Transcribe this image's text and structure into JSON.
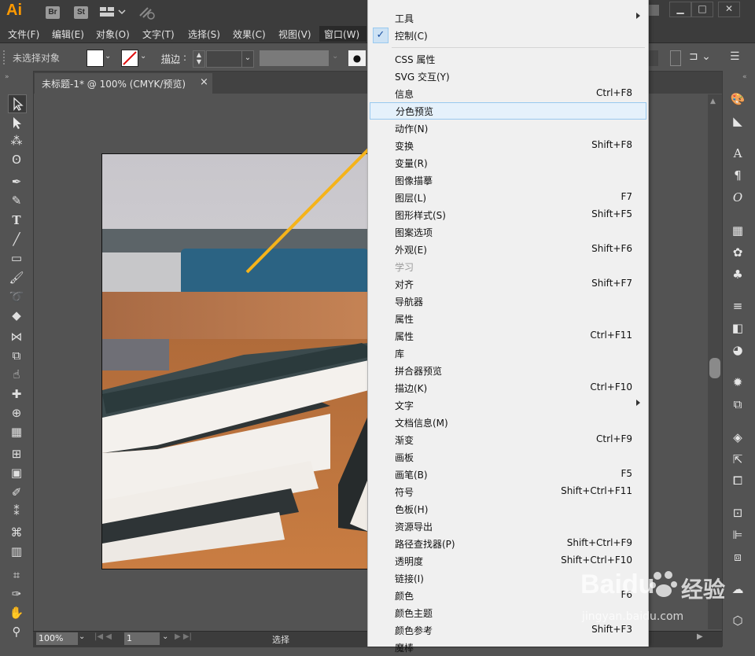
{
  "app": {
    "logo": "Ai",
    "bridge": "Br",
    "stock": "St"
  },
  "menubar": [
    "文件(F)",
    "编辑(E)",
    "对象(O)",
    "文字(T)",
    "选择(S)",
    "效果(C)",
    "视图(V)",
    "窗口(W)"
  ],
  "control_bar": {
    "selection_label": "未选择对象",
    "stroke_label": "描边",
    "colon": ":"
  },
  "document_tab": {
    "title": "未标题-1* @ 100% (CMYK/预览)",
    "close": "×"
  },
  "status_bar": {
    "zoom": "100%",
    "page": "1",
    "tool": "选择"
  },
  "window_menu": {
    "top_items": [
      {
        "label": "工具",
        "submenu": true
      },
      {
        "label": "控制(C)",
        "checked": true
      }
    ],
    "items": [
      {
        "label": "CSS 属性",
        "shortcut": ""
      },
      {
        "label": "SVG 交互(Y)",
        "shortcut": ""
      },
      {
        "label": "信息",
        "shortcut": "Ctrl+F8"
      },
      {
        "label": "分色预览",
        "shortcut": "",
        "highlighted": true
      },
      {
        "label": "动作(N)",
        "shortcut": ""
      },
      {
        "label": "变换",
        "shortcut": "Shift+F8"
      },
      {
        "label": "变量(R)",
        "shortcut": ""
      },
      {
        "label": "图像描摹",
        "shortcut": ""
      },
      {
        "label": "图层(L)",
        "shortcut": "F7"
      },
      {
        "label": "图形样式(S)",
        "shortcut": "Shift+F5"
      },
      {
        "label": "图案选项",
        "shortcut": ""
      },
      {
        "label": "外观(E)",
        "shortcut": "Shift+F6"
      },
      {
        "label": "学习",
        "shortcut": "",
        "disabled": true
      },
      {
        "label": "对齐",
        "shortcut": "Shift+F7"
      },
      {
        "label": "导航器",
        "shortcut": ""
      },
      {
        "label": "属性",
        "shortcut": ""
      },
      {
        "label": "属性",
        "shortcut": "Ctrl+F11"
      },
      {
        "label": "库",
        "shortcut": ""
      },
      {
        "label": "拼合器预览",
        "shortcut": ""
      },
      {
        "label": "描边(K)",
        "shortcut": "Ctrl+F10"
      },
      {
        "label": "文字",
        "shortcut": "",
        "submenu": true
      },
      {
        "label": "文档信息(M)",
        "shortcut": ""
      },
      {
        "label": "渐变",
        "shortcut": "Ctrl+F9"
      },
      {
        "label": "画板",
        "shortcut": ""
      },
      {
        "label": "画笔(B)",
        "shortcut": "F5"
      },
      {
        "label": "符号",
        "shortcut": "Shift+Ctrl+F11"
      },
      {
        "label": "色板(H)",
        "shortcut": ""
      },
      {
        "label": "资源导出",
        "shortcut": ""
      },
      {
        "label": "路径查找器(P)",
        "shortcut": "Shift+Ctrl+F9"
      },
      {
        "label": "透明度",
        "shortcut": "Shift+Ctrl+F10"
      },
      {
        "label": "链接(I)",
        "shortcut": ""
      },
      {
        "label": "颜色",
        "shortcut": "F6"
      },
      {
        "label": "颜色主题",
        "shortcut": ""
      },
      {
        "label": "颜色参考",
        "shortcut": "Shift+F3"
      },
      {
        "label": "魔棒",
        "shortcut": ""
      }
    ]
  },
  "watermark": {
    "brand": "Baidu",
    "cn": "经验",
    "url": "jingyan.baidu.com"
  },
  "colors": {
    "accent_arrow": "#f5b31a",
    "menu_highlight": "#e5f1fb",
    "check": "#1a4fa0"
  }
}
